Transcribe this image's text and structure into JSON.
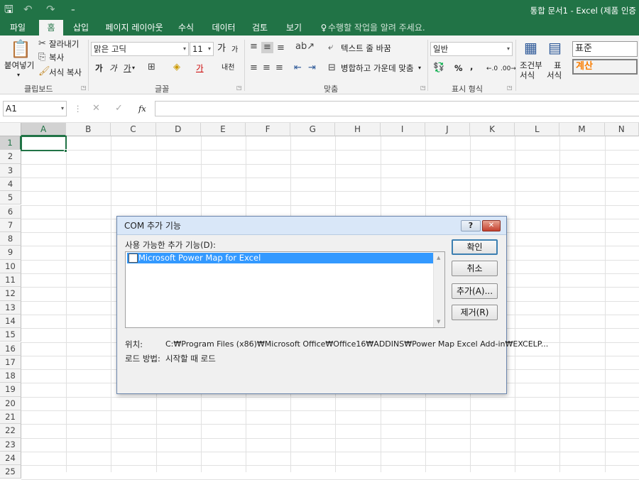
{
  "titlebar": {
    "title": "통합 문서1 - Excel (제품 인증",
    "quick_access": {
      "save": "🖫",
      "undo": "↶",
      "redo": "↷",
      "customize": "₌"
    }
  },
  "tabs": [
    "파일",
    "홈",
    "삽입",
    "페이지 레이아웃",
    "수식",
    "데이터",
    "검토",
    "보기"
  ],
  "active_tab": "홈",
  "tell_me": "수행할 작업을 알려 주세요.",
  "ribbon": {
    "clipboard": {
      "paste": "붙여넣기",
      "cut": "잘라내기",
      "copy": "복사",
      "format_painter": "서식 복사",
      "group": "클립보드"
    },
    "font": {
      "name": "맑은 고딕",
      "size": "11",
      "grow": "가",
      "shrink": "가",
      "bold": "가",
      "italic": "가",
      "underline": "가",
      "font_color_glyph": "가",
      "phonetic": "내천",
      "group": "글꼴"
    },
    "alignment": {
      "wrap_text": "텍스트 줄 바꿈",
      "merge_center": "병합하고 가운데 맞춤",
      "group": "맞춤"
    },
    "number": {
      "format": "일반",
      "percent": "%",
      "comma": ",",
      "group": "표시 형식"
    },
    "styles": {
      "conditional": "조건부",
      "conditional2": "서식",
      "table": "표",
      "table2": "서식",
      "style_normal": "표준",
      "style_calc": "계산"
    }
  },
  "formula_bar": {
    "name_box": "A1",
    "fx": "fx",
    "formula": ""
  },
  "grid": {
    "columns": [
      "A",
      "B",
      "C",
      "D",
      "E",
      "F",
      "G",
      "H",
      "I",
      "J",
      "K",
      "L",
      "M",
      "N"
    ],
    "rows": [
      "1",
      "2",
      "3",
      "4",
      "5",
      "6",
      "7",
      "8",
      "9",
      "10",
      "11",
      "12",
      "13",
      "14",
      "15",
      "16",
      "17",
      "18",
      "19",
      "20",
      "21",
      "22",
      "23",
      "24",
      "25"
    ]
  },
  "dialog": {
    "title": "COM 추가 기능",
    "help": "?",
    "close": "✕",
    "list_label": "사용 가능한 추가 기능(D):",
    "addins": [
      {
        "name": "Microsoft Power Map for Excel",
        "checked": false
      }
    ],
    "location_label": "위치:",
    "location": "C:₩Program Files (x86)₩Microsoft Office₩Office16₩ADDINS₩Power Map Excel Add-in₩EXCELP...",
    "load_label": "로드 방법:",
    "load": "시작할 때 로드",
    "buttons": {
      "ok": "확인",
      "cancel": "취소",
      "add": "추가(A)...",
      "remove": "제거(R)"
    }
  },
  "colors": {
    "accent": "#217346",
    "selection": "#3399ff",
    "dialog_border": "#6b86ad"
  }
}
